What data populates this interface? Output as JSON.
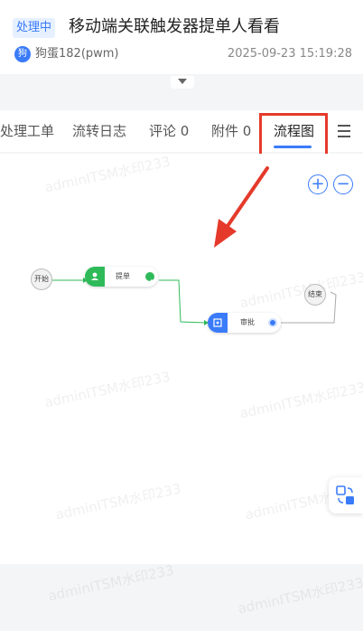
{
  "ticket": {
    "status": "处理中",
    "title": "移动端关联触发器提单人看看",
    "author": "狗蛋182(pwm)",
    "avatar_text": "狗",
    "datetime": "2025-09-23 15:19:28"
  },
  "tabs": [
    {
      "label": "处理工单",
      "active": false
    },
    {
      "label": "流转日志",
      "active": false
    },
    {
      "label": "评论 0",
      "active": false
    },
    {
      "label": "附件 0",
      "active": false
    },
    {
      "label": "流程图",
      "active": true
    }
  ],
  "flow": {
    "start_label": "开始",
    "end_label": "结束",
    "nodes": [
      {
        "label": "提单",
        "state": "completed",
        "color": "#2fba5a"
      },
      {
        "label": "审批",
        "state": "in-progress",
        "color": "#3a7bfa"
      }
    ]
  },
  "watermark": "adminITSM水印233",
  "colors": {
    "accent": "#3a7bfa",
    "success": "#2fba5a",
    "annotation": "#e53a2b"
  },
  "icons": {
    "menu": "menu-icon",
    "zoom_in": "zoom-in-icon",
    "zoom_out": "zoom-out-icon",
    "translate": "translate-icon",
    "expand": "chevron-down-icon"
  }
}
